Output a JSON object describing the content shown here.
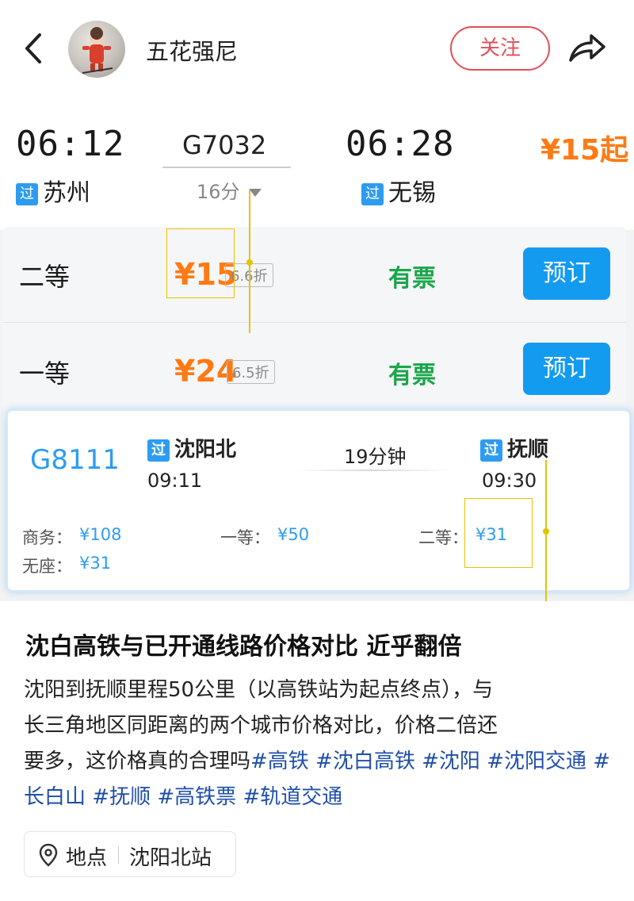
{
  "header": {
    "author_name": "五花强尼",
    "follow_label": "关注"
  },
  "train1": {
    "depart_time": "06:12",
    "depart_badge": "过",
    "depart_station": "苏州",
    "train_no": "G7032",
    "duration": "16分",
    "arrive_time": "06:28",
    "arrive_badge": "过",
    "arrive_station": "无锡",
    "min_price": "¥15起",
    "seats": [
      {
        "label": "二等",
        "price": "¥15",
        "discount": "6.6折",
        "availability": "有票",
        "book_label": "预订"
      },
      {
        "label": "一等",
        "price": "¥24",
        "discount": "6.5折",
        "availability": "有票",
        "book_label": "预订"
      }
    ]
  },
  "train2": {
    "train_no": "G8111",
    "depart_badge": "过",
    "depart_station": "沈阳北",
    "depart_time": "09:11",
    "duration": "19分钟",
    "arrive_badge": "过",
    "arrive_station": "抚顺",
    "arrive_time": "09:30",
    "prices": {
      "business_label": "商务：",
      "business_price": "¥108",
      "first_label": "一等：",
      "first_price": "¥50",
      "second_label": "二等：",
      "second_price": "¥31",
      "noseat_label": "无座：",
      "noseat_price": "¥31"
    }
  },
  "article": {
    "title": "沈白高铁与已开通线路价格对比 近乎翻倍",
    "body_line1": "沈阳到抚顺里程50公里（以高铁站为起点终点），与",
    "body_line2": "长三角地区同距离的两个城市价格对比，价格二倍还",
    "body_line3_text": "要多，这价格真的合理吗",
    "tags": [
      "#高铁",
      "#沈白高铁",
      "#沈阳",
      "#沈阳交通",
      "#长白山",
      "#抚顺",
      "#高铁票",
      "#轨道交通"
    ],
    "location_label": "地点",
    "location_value": "沈阳北站"
  },
  "colors": {
    "accent_red": "#e0505a",
    "price_orange": "#ff7a13",
    "ticket_green": "#1aa64a",
    "button_blue": "#139bf0",
    "hashtag_blue": "#1f4fa8"
  },
  "icons": [
    "back-arrow-icon",
    "share-arrow-icon",
    "dropdown-triangle-icon",
    "location-pin-icon"
  ]
}
